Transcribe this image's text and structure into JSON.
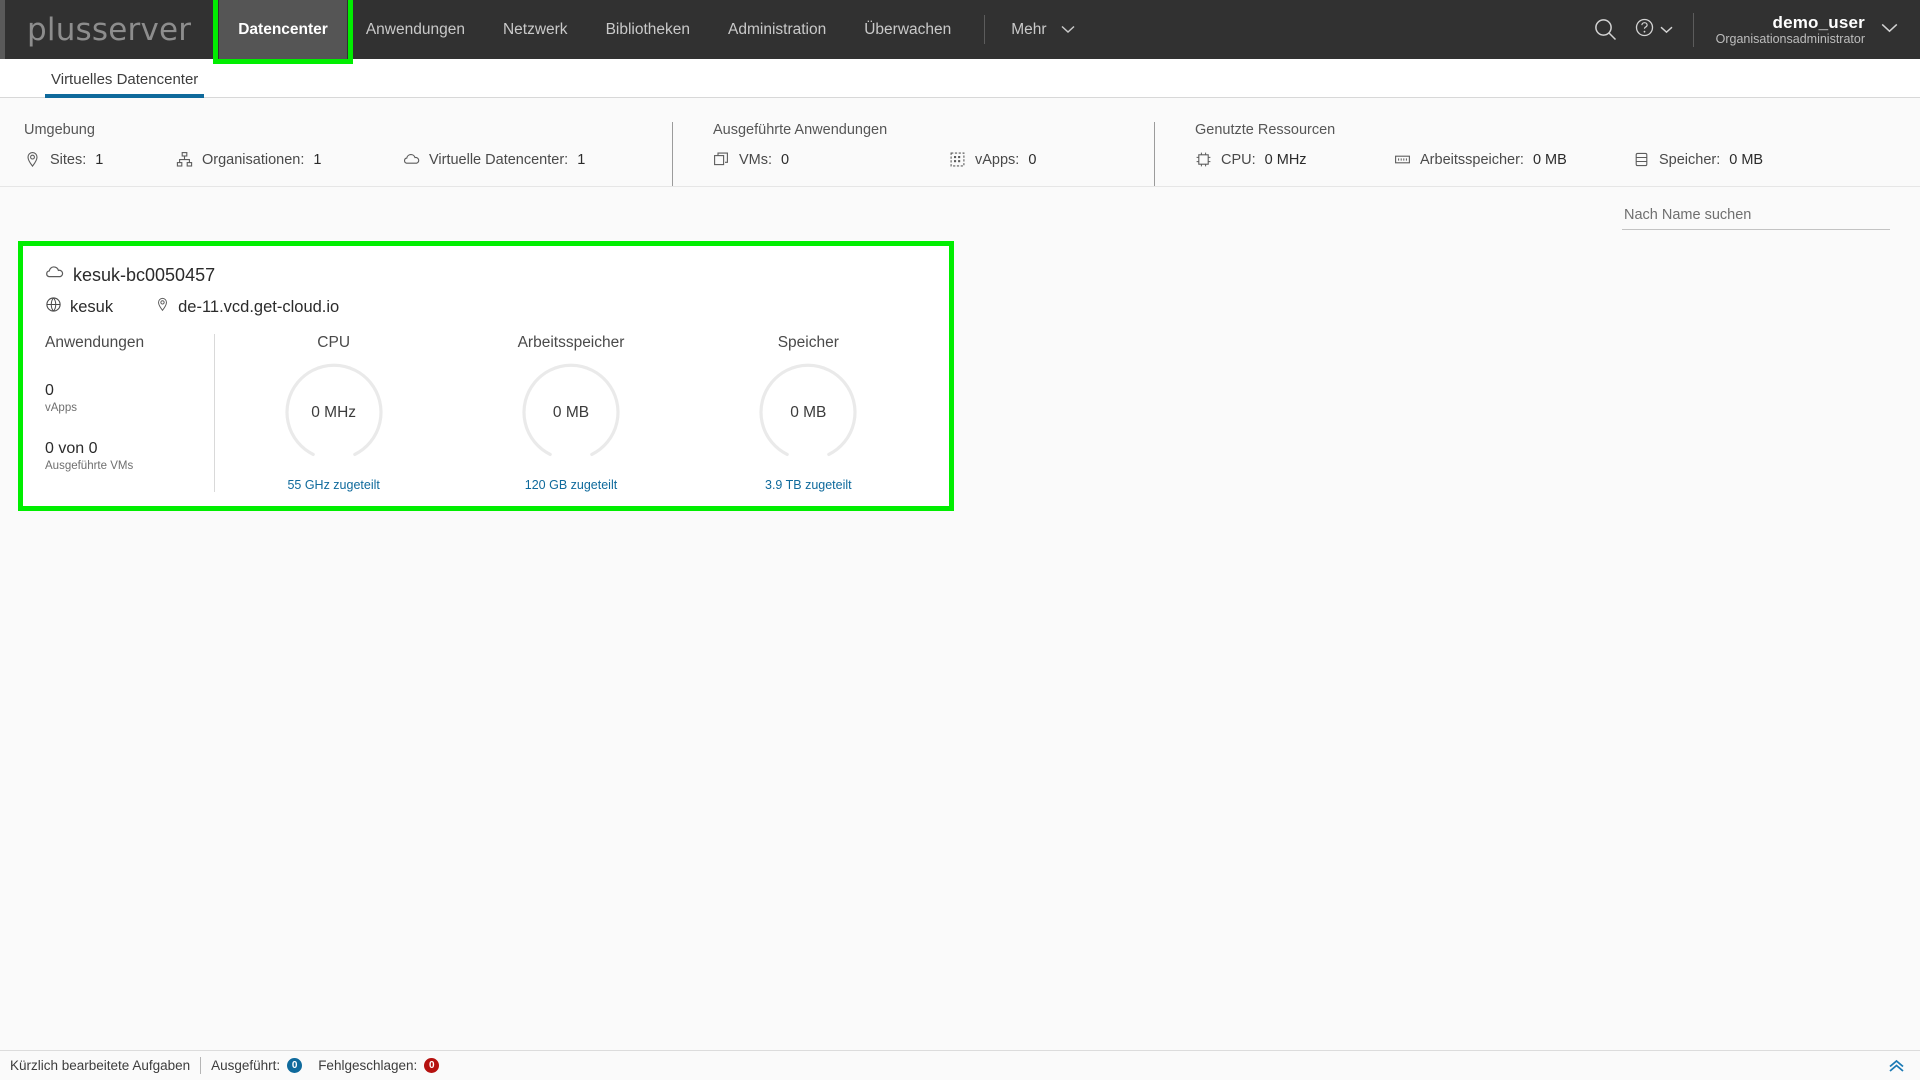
{
  "brand": {
    "logo_text": "plusserver",
    "accent_green": "#00ee00",
    "accent_blue": "#0f6a9c"
  },
  "header": {
    "nav": [
      {
        "label": "Datencenter",
        "active": true
      },
      {
        "label": "Anwendungen",
        "active": false
      },
      {
        "label": "Netzwerk",
        "active": false
      },
      {
        "label": "Bibliotheken",
        "active": false
      },
      {
        "label": "Administration",
        "active": false
      },
      {
        "label": "Überwachen",
        "active": false
      }
    ],
    "more_label": "Mehr",
    "search_icon": "search-icon",
    "help_icon": "help-circle-icon",
    "user": {
      "name": "demo_user",
      "role": "Organisationsadministrator"
    }
  },
  "subtabs": [
    {
      "label": "Virtuelles Datencenter",
      "active": true
    }
  ],
  "summary": {
    "groups": [
      {
        "title": "Umgebung",
        "items": [
          {
            "icon": "location-pin-icon",
            "label": "Sites:",
            "value": "1"
          },
          {
            "icon": "organization-icon",
            "label": "Organisationen:",
            "value": "1"
          },
          {
            "icon": "cloud-icon",
            "label": "Virtuelle Datencenter:",
            "value": "1"
          }
        ]
      },
      {
        "title": "Ausgeführte Anwendungen",
        "items": [
          {
            "icon": "vm-icon",
            "label": "VMs:",
            "value": "0"
          },
          {
            "icon": "vapp-grid-icon",
            "label": "vApps:",
            "value": "0"
          }
        ]
      },
      {
        "title": "Genutzte Ressourcen",
        "items": [
          {
            "icon": "cpu-chip-icon",
            "label": "CPU:",
            "value": "0 MHz"
          },
          {
            "icon": "memory-icon",
            "label": "Arbeitsspeicher:",
            "value": "0 MB"
          },
          {
            "icon": "storage-database-icon",
            "label": "Speicher:",
            "value": "0 MB"
          }
        ]
      }
    ]
  },
  "search": {
    "placeholder": "Nach Name suchen",
    "value": ""
  },
  "vdc_card": {
    "highlighted": true,
    "title": "kesuk-bc0050457",
    "title_icon": "cloud-icon",
    "org": {
      "icon": "globe-icon",
      "label": "kesuk"
    },
    "site": {
      "icon": "location-pin-icon",
      "label": "de-11.vcd.get-cloud.io"
    },
    "applications": {
      "heading": "Anwendungen",
      "blocks": [
        {
          "value": "0",
          "label": "vApps"
        },
        {
          "value": "0 von 0",
          "label": "Ausgeführte VMs"
        }
      ]
    },
    "gauges": [
      {
        "label": "CPU",
        "value": "0 MHz",
        "allocated": "55 GHz zugeteilt",
        "percent": 0
      },
      {
        "label": "Arbeitsspeicher",
        "value": "0 MB",
        "allocated": "120 GB zugeteilt",
        "percent": 0
      },
      {
        "label": "Speicher",
        "value": "0 MB",
        "allocated": "3.9 TB zugeteilt",
        "percent": 0
      }
    ]
  },
  "footer": {
    "tasks_label": "Kürzlich bearbeitete Aufgaben",
    "running_label": "Ausgeführt:",
    "running_count": "0",
    "running_color": "#0f6a9c",
    "failed_label": "Fehlgeschlagen:",
    "failed_count": "0",
    "failed_color": "#b5110f",
    "expand_icon": "double-chevron-up-icon"
  }
}
